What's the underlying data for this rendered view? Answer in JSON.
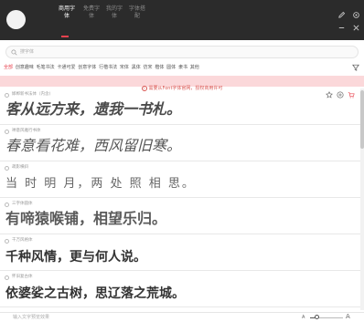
{
  "header": {
    "tabs": [
      {
        "label": "商用字体",
        "active": true
      },
      {
        "label": "免费字体",
        "active": false
      },
      {
        "label": "我的字体",
        "active": false
      },
      {
        "label": "字体搭配",
        "active": false
      }
    ],
    "icons": [
      "pencil-icon",
      "settings-icon",
      "minimize-icon",
      "close-icon"
    ]
  },
  "search": {
    "placeholder": "搜字体"
  },
  "categories": {
    "items": [
      {
        "label": "全部",
        "active": true
      },
      {
        "label": "创意趣味",
        "active": false
      },
      {
        "label": "毛笔书法",
        "active": false
      },
      {
        "label": "卡通可爱",
        "active": false
      },
      {
        "label": "创意字体",
        "active": false
      },
      {
        "label": "行楷书法",
        "active": false
      },
      {
        "label": "宋体",
        "active": false
      },
      {
        "label": "黑体",
        "active": false
      },
      {
        "label": "仿宋",
        "active": false
      },
      {
        "label": "楷体",
        "active": false
      },
      {
        "label": "圆体",
        "active": false
      },
      {
        "label": "隶书",
        "active": false
      },
      {
        "label": "其他",
        "active": false
      }
    ]
  },
  "notice": {
    "icon": "info-icon",
    "text": "需要从Font字体官网，授权商用许可"
  },
  "fonts": [
    {
      "name": "邯郸新书法体（内含)",
      "preview": "客从远方来，遗我一书札。",
      "style": "style-brush"
    },
    {
      "name": "禅意风雅行书体",
      "preview": "春意看花难，西风留旧寒。",
      "style": "style-script"
    },
    {
      "name": "疏影横斜",
      "preview": "当 时 明 月，两 处 照 相 思。",
      "style": "style-thin"
    },
    {
      "name": "三字体圆体",
      "preview": "有啼猿喉铺，相望乐归。",
      "style": "style-round"
    },
    {
      "name": "千万风格体",
      "preview": "千种风情，更与何人说。",
      "style": "style-bold"
    },
    {
      "name": "怀旧复古体",
      "preview": "依婆娑之古树，思辽落之荒城。",
      "style": "style-bold"
    }
  ],
  "item_actions": [
    "favorite-icon",
    "add-icon",
    "cart-icon"
  ],
  "bottom": {
    "preview_placeholder": "输入文字预览效果",
    "size_small_label": "A",
    "size_large_label": "A",
    "size_level": 0.22
  },
  "colors": {
    "accent": "#e8424e",
    "header_bg": "#2b2b2b",
    "notice_bg": "#fbd8da",
    "notice_text": "#d9534f"
  }
}
